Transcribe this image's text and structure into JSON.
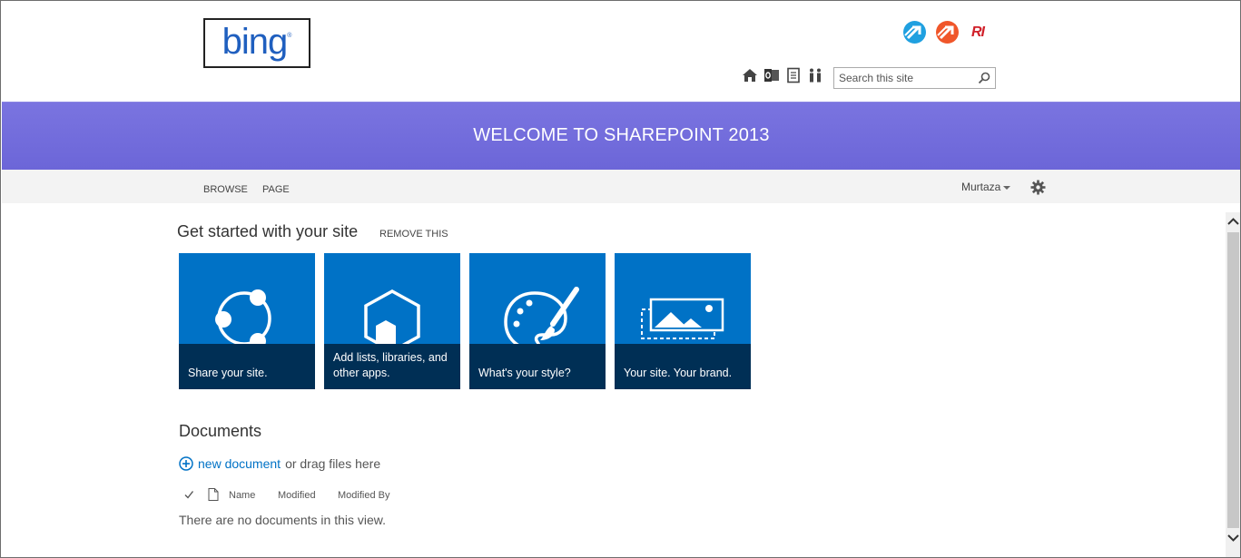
{
  "header": {
    "logo_text": "bing",
    "logo_tm": "®",
    "brand_ri_text": "RI",
    "search": {
      "placeholder": "Search this site",
      "value": ""
    },
    "quick_icons": [
      "home-icon",
      "outlook-icon",
      "notebook-icon",
      "people-icon"
    ]
  },
  "banner": {
    "title": "WELCOME TO SHAREPOINT 2013"
  },
  "ribbon": {
    "tabs": [
      {
        "label": "BROWSE"
      },
      {
        "label": "PAGE"
      }
    ],
    "user_name": "Murtaza"
  },
  "get_started": {
    "title": "Get started with your site",
    "remove_label": "REMOVE THIS",
    "tiles": [
      {
        "label": "Share your site.",
        "icon": "share-icon"
      },
      {
        "label": "Add lists, libraries, and other apps.",
        "icon": "apps-icon"
      },
      {
        "label": "What's your style?",
        "icon": "palette-icon"
      },
      {
        "label": "Your site. Your brand.",
        "icon": "brand-image-icon"
      }
    ]
  },
  "documents": {
    "title": "Documents",
    "new_document_label": "new document",
    "drag_text": "or drag files here",
    "columns": [
      "Name",
      "Modified",
      "Modified By"
    ],
    "empty_message": "There are no documents in this view."
  },
  "colors": {
    "banner": "#7a74e0",
    "tile": "#0072c6",
    "tile_bar": "#002f55",
    "link": "#0072c6",
    "brand_red": "#d0202a",
    "brand_blue": "#1fa0e0",
    "brand_orange": "#f0562a"
  }
}
